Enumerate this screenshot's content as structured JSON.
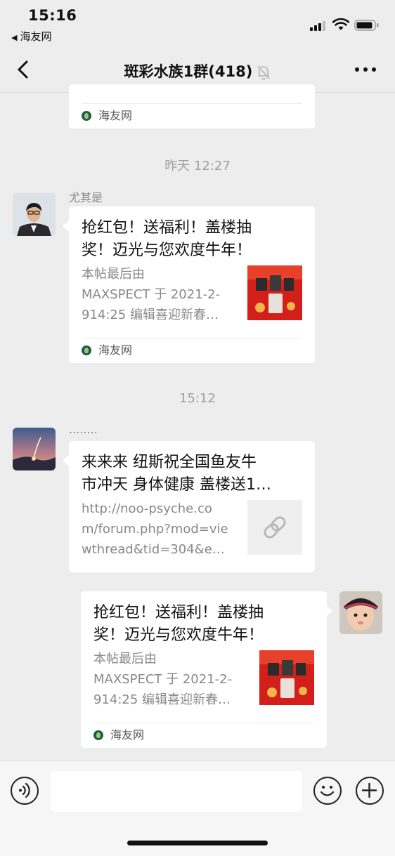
{
  "status_bar": {
    "time": "15:16",
    "back_app": "海友网",
    "back_app_arrow": "◀"
  },
  "nav": {
    "title": "斑彩水族1群(418)",
    "back_icon": "chevron-left-icon",
    "more_icon": "more-icon",
    "mute_icon": "bell-slash-icon"
  },
  "messages": [
    {
      "type": "link-card-partial",
      "source": "海友网"
    },
    {
      "type": "timestamp",
      "text": "昨天 12:27"
    },
    {
      "type": "link-card",
      "sender": "尤其是",
      "title_line1": "抢红包！送福利！盖楼抽",
      "title_line2": "奖！迈光与您欢度牛年！",
      "desc_line1": "本帖最后由",
      "desc_line2": "MAXSPECT 于 2021-2-",
      "desc_line3": "914:25 编辑喜迎新春…",
      "source": "海友网"
    },
    {
      "type": "timestamp",
      "text": "15:12"
    },
    {
      "type": "link-card",
      "sender": "........",
      "title_line1": "来来来 纽斯祝全国鱼友牛",
      "title_line2": "市冲天 身体健康 盖楼送1…",
      "desc_line1": "http://noo-psyche.co",
      "desc_line2": "m/forum.php?mod=vie",
      "desc_line3": "wthread&tid=304&e…",
      "thumb_icon": "link-icon"
    },
    {
      "type": "link-card-self",
      "title_line1": "抢红包！送福利！盖楼抽",
      "title_line2": "奖！迈光与您欢度牛年！",
      "desc_line1": "本帖最后由",
      "desc_line2": "MAXSPECT 于 2021-2-",
      "desc_line3": "914:25 编辑喜迎新春…",
      "source": "海友网"
    }
  ],
  "input_bar": {
    "placeholder": "",
    "voice_icon": "voice-icon",
    "emoji_icon": "emoji-icon",
    "plus_icon": "plus-icon"
  },
  "colors": {
    "background": "#ededed",
    "card": "#ffffff",
    "timestamp": "#a0a0a0",
    "source_icon": "#1e5b4d",
    "thumb_red": "#d21f1a"
  }
}
